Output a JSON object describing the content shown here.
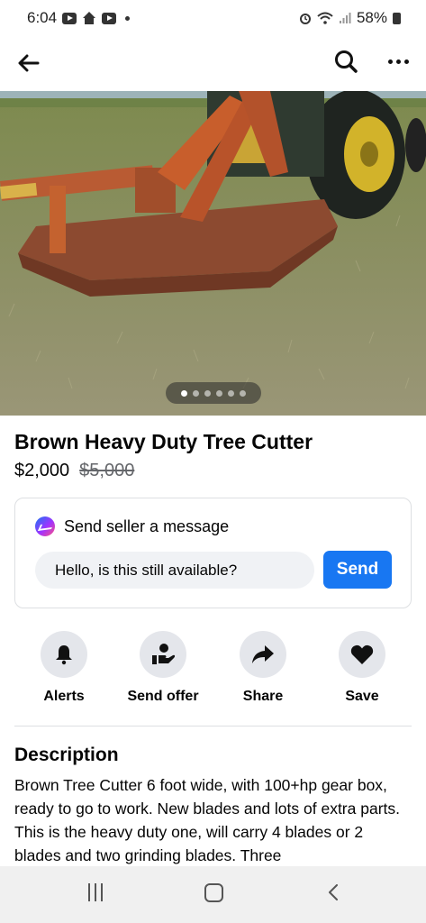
{
  "status_bar": {
    "time": "6:04",
    "battery": "58%",
    "icons": [
      "youtube-icon",
      "home-app-icon",
      "youtube-icon",
      "notification-dot-icon",
      "alarm-icon",
      "wifi-icon",
      "signal-icon",
      "battery-icon"
    ]
  },
  "app_bar": {
    "icons": [
      "back-arrow-icon",
      "search-icon",
      "more-options-icon"
    ]
  },
  "photo": {
    "page_count": 6,
    "active_page": 1
  },
  "listing": {
    "title": "Brown Heavy Duty Tree Cutter",
    "price": "$2,000",
    "original_price": "$5,000"
  },
  "message_card": {
    "header": "Send seller a message",
    "input_value": "Hello, is this still available?",
    "send_label": "Send"
  },
  "actions": [
    {
      "label": "Alerts",
      "icon": "bell-icon"
    },
    {
      "label": "Send offer",
      "icon": "offer-hand-icon"
    },
    {
      "label": "Share",
      "icon": "share-arrow-icon"
    },
    {
      "label": "Save",
      "icon": "heart-icon"
    }
  ],
  "description": {
    "heading": "Description",
    "body": "Brown Tree Cutter 6 foot wide, with 100+hp gear box, ready to go to work. New blades and lots of extra parts. This is the heavy duty one, will carry 4 blades or 2 blades and two grinding blades. Three"
  },
  "colors": {
    "accent": "#1877f2",
    "input_bg": "#f0f2f5",
    "action_circle_bg": "#e4e6eb",
    "secondary_text": "#65676b",
    "divider": "#dddfe2"
  }
}
